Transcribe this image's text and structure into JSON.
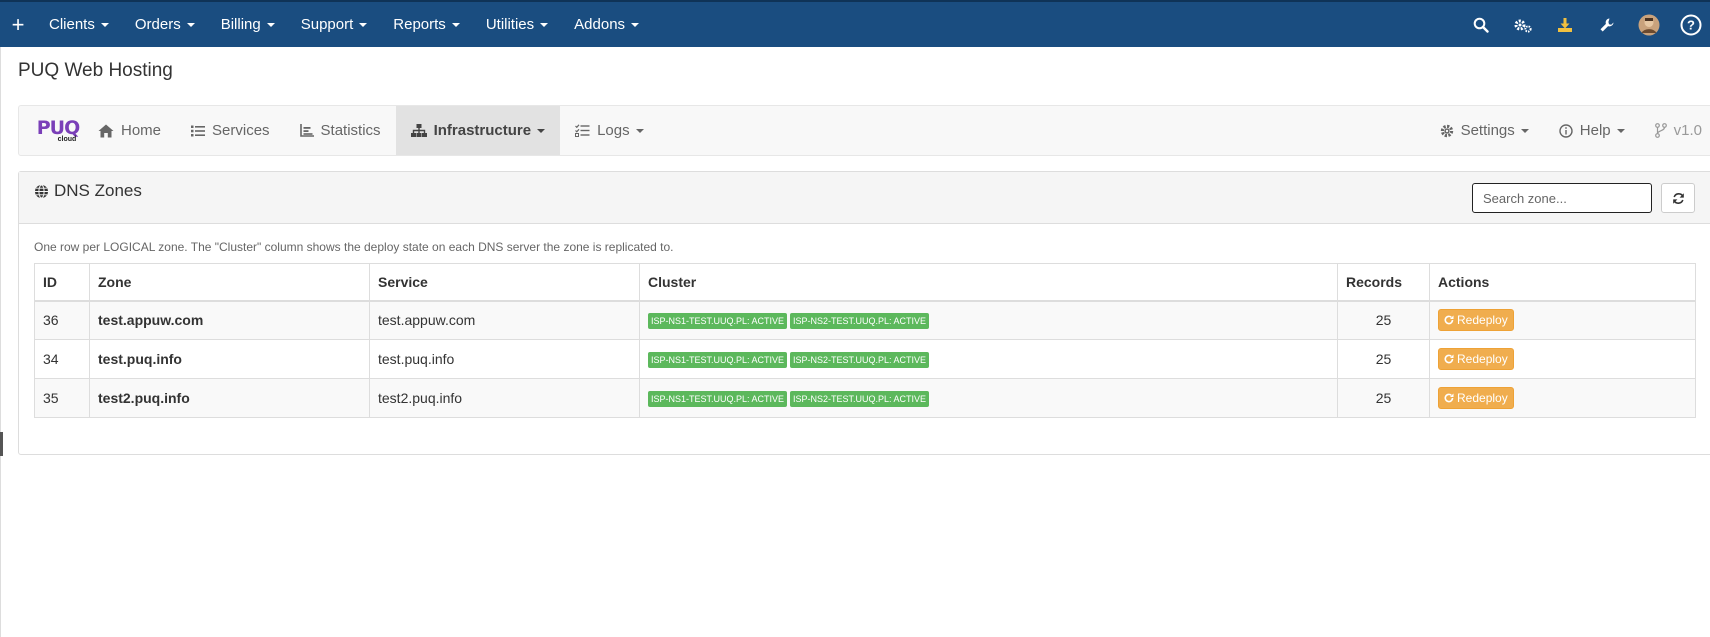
{
  "topnav": {
    "plus": "+",
    "items": [
      {
        "label": "Clients"
      },
      {
        "label": "Orders"
      },
      {
        "label": "Billing"
      },
      {
        "label": "Support"
      },
      {
        "label": "Reports"
      },
      {
        "label": "Utilities"
      },
      {
        "label": "Addons"
      }
    ],
    "right_icons": [
      "search-icon",
      "gears-icon",
      "download-icon",
      "wrench-icon",
      "avatar",
      "help-icon"
    ]
  },
  "page": {
    "title": "PUQ Web Hosting"
  },
  "module_nav": {
    "logo_text": "PUQ",
    "logo_sub": "cloud",
    "items": [
      {
        "label": "Home",
        "icon": "home-icon"
      },
      {
        "label": "Services",
        "icon": "list-icon"
      },
      {
        "label": "Statistics",
        "icon": "chart-icon"
      },
      {
        "label": "Infrastructure",
        "icon": "sitemap-icon",
        "active": true
      },
      {
        "label": "Logs",
        "icon": "tasks-icon"
      }
    ],
    "right": [
      {
        "label": "Settings",
        "icon": "gear-icon"
      },
      {
        "label": "Help",
        "icon": "info-icon"
      },
      {
        "label": "v1.0",
        "icon": "branch-icon"
      }
    ]
  },
  "panel": {
    "title": "DNS Zones",
    "search_placeholder": "Search zone...",
    "hint": "One row per LOGICAL zone. The \"Cluster\" column shows the deploy state on each DNS server the zone is replicated to.",
    "columns": [
      "ID",
      "Zone",
      "Service",
      "Cluster",
      "Records",
      "Actions"
    ],
    "rows": [
      {
        "id": "36",
        "zone": "test.appuw.com",
        "service": "test.appuw.com",
        "cluster": [
          "ISP-NS1-TEST.UUQ.PL: ACTIVE",
          "ISP-NS2-TEST.UUQ.PL: ACTIVE"
        ],
        "records": "25",
        "action": "Redeploy"
      },
      {
        "id": "34",
        "zone": "test.puq.info",
        "service": "test.puq.info",
        "cluster": [
          "ISP-NS1-TEST.UUQ.PL: ACTIVE",
          "ISP-NS2-TEST.UUQ.PL: ACTIVE"
        ],
        "records": "25",
        "action": "Redeploy"
      },
      {
        "id": "35",
        "zone": "test2.puq.info",
        "service": "test2.puq.info",
        "cluster": [
          "ISP-NS1-TEST.UUQ.PL: ACTIVE",
          "ISP-NS2-TEST.UUQ.PL: ACTIVE"
        ],
        "records": "25",
        "action": "Redeploy"
      }
    ]
  },
  "colors": {
    "navbar": "#1a4d80",
    "badge_active": "#5cb85c",
    "btn_warning": "#f0ad4e",
    "logo": "#7a3fb8"
  }
}
